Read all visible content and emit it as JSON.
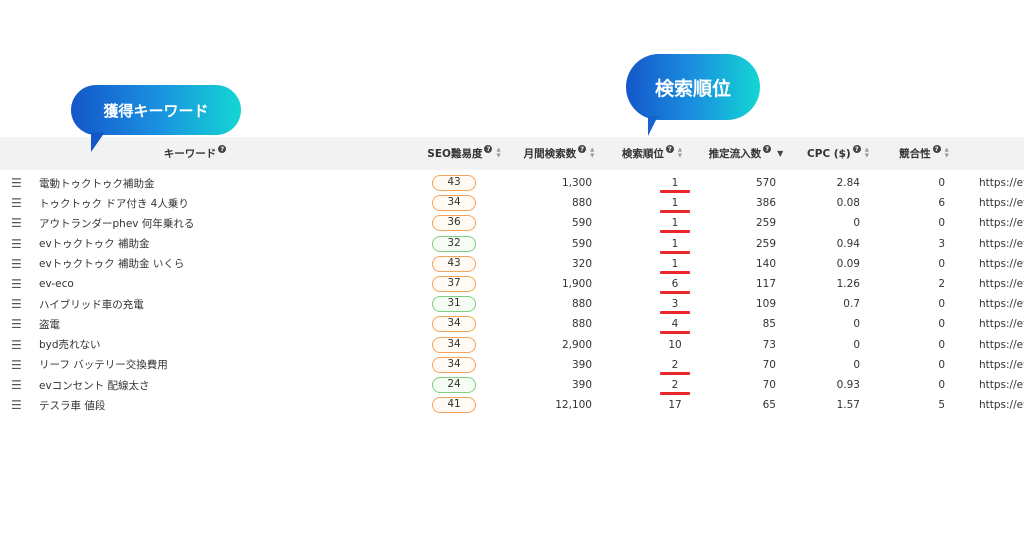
{
  "bubbles": {
    "keyword": "獲得キーワード",
    "rank": "検索順位"
  },
  "columns": {
    "keyword": "キーワード",
    "seo": "SEO難易度",
    "volume": "月間検索数",
    "rank": "検索順位",
    "traffic": "推定流入数",
    "cpc": "CPC ($)",
    "competition": "競合性"
  },
  "help_glyph": "?",
  "handle_glyph": "☰",
  "rows": [
    {
      "keyword": "電動トゥクトゥク補助金",
      "seo": "43",
      "seo_level": "orange",
      "volume": "1,300",
      "rank": "1",
      "rank_underline": true,
      "traffic": "570",
      "cpc": "2.84",
      "competition": "0",
      "url": "https://ev"
    },
    {
      "keyword": "トゥクトゥク ドア付き 4人乗り",
      "seo": "34",
      "seo_level": "orange",
      "volume": "880",
      "rank": "1",
      "rank_underline": true,
      "traffic": "386",
      "cpc": "0.08",
      "competition": "6",
      "url": "https://ev"
    },
    {
      "keyword": "アウトランダーphev 何年乗れる",
      "seo": "36",
      "seo_level": "orange",
      "volume": "590",
      "rank": "1",
      "rank_underline": true,
      "traffic": "259",
      "cpc": "0",
      "competition": "0",
      "url": "https://ev"
    },
    {
      "keyword": "evトゥクトゥク 補助金",
      "seo": "32",
      "seo_level": "green",
      "volume": "590",
      "rank": "1",
      "rank_underline": true,
      "traffic": "259",
      "cpc": "0.94",
      "competition": "3",
      "url": "https://ev"
    },
    {
      "keyword": "evトゥクトゥク 補助金 いくら",
      "seo": "43",
      "seo_level": "orange",
      "volume": "320",
      "rank": "1",
      "rank_underline": true,
      "traffic": "140",
      "cpc": "0.09",
      "competition": "0",
      "url": "https://ev"
    },
    {
      "keyword": "ev-eco",
      "seo": "37",
      "seo_level": "orange",
      "volume": "1,900",
      "rank": "6",
      "rank_underline": true,
      "traffic": "117",
      "cpc": "1.26",
      "competition": "2",
      "url": "https://ev"
    },
    {
      "keyword": "ハイブリッド車の充電",
      "seo": "31",
      "seo_level": "green",
      "volume": "880",
      "rank": "3",
      "rank_underline": true,
      "traffic": "109",
      "cpc": "0.7",
      "competition": "0",
      "url": "https://ev"
    },
    {
      "keyword": "盗電",
      "seo": "34",
      "seo_level": "orange",
      "volume": "880",
      "rank": "4",
      "rank_underline": true,
      "traffic": "85",
      "cpc": "0",
      "competition": "0",
      "url": "https://ev"
    },
    {
      "keyword": "byd売れない",
      "seo": "34",
      "seo_level": "orange",
      "volume": "2,900",
      "rank": "10",
      "rank_underline": false,
      "traffic": "73",
      "cpc": "0",
      "competition": "0",
      "url": "https://ev"
    },
    {
      "keyword": "リーフ バッテリー交換費用",
      "seo": "34",
      "seo_level": "orange",
      "volume": "390",
      "rank": "2",
      "rank_underline": true,
      "traffic": "70",
      "cpc": "0",
      "competition": "0",
      "url": "https://ev"
    },
    {
      "keyword": "evコンセント 配線太さ",
      "seo": "24",
      "seo_level": "green",
      "volume": "390",
      "rank": "2",
      "rank_underline": true,
      "traffic": "70",
      "cpc": "0.93",
      "competition": "0",
      "url": "https://ev"
    },
    {
      "keyword": "テスラ車 値段",
      "seo": "41",
      "seo_level": "orange",
      "volume": "12,100",
      "rank": "17",
      "rank_underline": false,
      "traffic": "65",
      "cpc": "1.57",
      "competition": "5",
      "url": "https://ev"
    }
  ],
  "colors": {
    "pill_orange": "#f4a45a",
    "pill_green": "#7fcf80",
    "rank_underline": "#e8262c",
    "bubble_gradient_start": "#1457c9",
    "bubble_gradient_end": "#14d6d2"
  }
}
